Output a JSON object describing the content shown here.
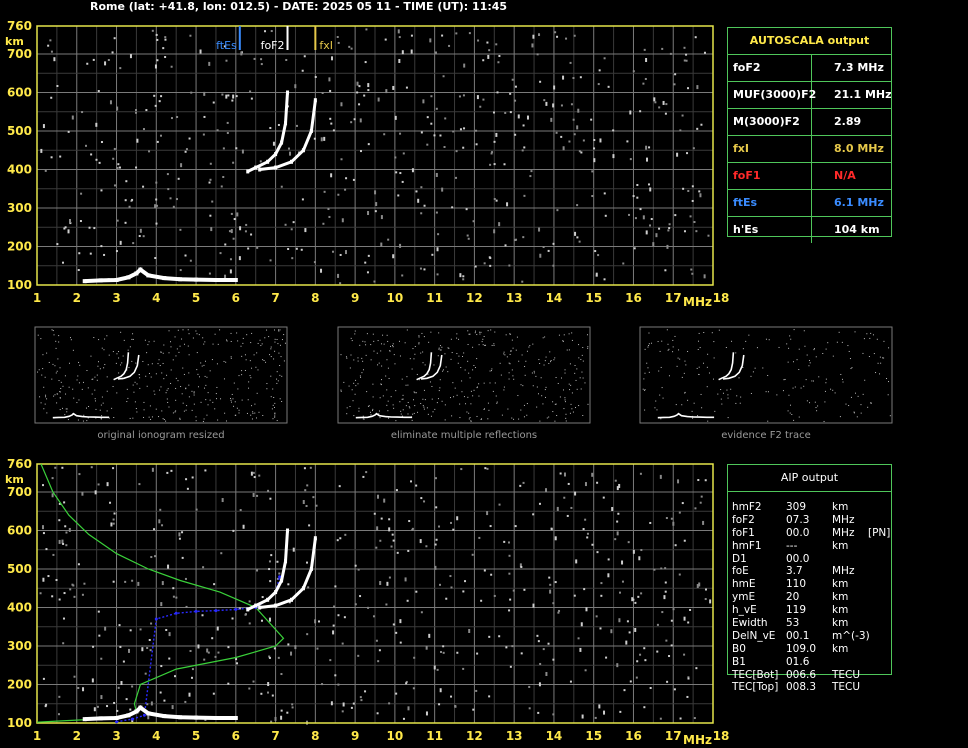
{
  "header": "Rome (lat: +41.8, lon: 012.5) - DATE: 2025 05 11 - TIME (UT): 11:45",
  "axes": {
    "x_ticks": [
      "1",
      "2",
      "3",
      "4",
      "5",
      "6",
      "7",
      "8",
      "9",
      "10",
      "11",
      "12",
      "13",
      "14",
      "15",
      "16",
      "17",
      "18"
    ],
    "y_ticks": [
      "760",
      "700",
      "600",
      "500",
      "400",
      "300",
      "200",
      "100"
    ],
    "x_unit": "MHz",
    "y_unit": "km"
  },
  "top_plot_labels": {
    "ftEs": "ftEs",
    "foF2": "foF2",
    "fxI": "fxI"
  },
  "autoscala": {
    "title": "AUTOSCALA output",
    "rows": [
      {
        "name": "foF2",
        "value": "7.3 MHz",
        "color": "#ffffff"
      },
      {
        "name": "MUF(3000)F2",
        "value": "21.1 MHz",
        "color": "#ffffff"
      },
      {
        "name": "M(3000)F2",
        "value": "2.89",
        "color": "#ffffff"
      },
      {
        "name": "fxI",
        "value": "8.0 MHz",
        "color": "#e6c84a"
      },
      {
        "name": "foF1",
        "value": "N/A",
        "color": "#ff2a2a"
      },
      {
        "name": "ftEs",
        "value": "6.1 MHz",
        "color": "#3a8cff"
      },
      {
        "name": "h'Es",
        "value": "104    km",
        "color": "#ffffff"
      }
    ]
  },
  "thumbnails": [
    {
      "caption": "original ionogram resized"
    },
    {
      "caption": "eliminate multiple reflections"
    },
    {
      "caption": "evidence F2 trace"
    }
  ],
  "aip": {
    "title": "AIP output",
    "rows": [
      {
        "k": "hmF2",
        "v": "309",
        "u": "km",
        "e": ""
      },
      {
        "k": "foF2",
        "v": "07.3",
        "u": "MHz",
        "e": ""
      },
      {
        "k": "foF1",
        "v": "00.0",
        "u": "MHz",
        "e": "[PN]"
      },
      {
        "k": "hmF1",
        "v": "---",
        "u": "km",
        "e": ""
      },
      {
        "k": "D1",
        "v": "00.0",
        "u": "",
        "e": ""
      },
      {
        "k": "foE",
        "v": "3.7",
        "u": "MHz",
        "e": ""
      },
      {
        "k": "hmE",
        "v": "110",
        "u": "km",
        "e": ""
      },
      {
        "k": "ymE",
        "v": "20",
        "u": "km",
        "e": ""
      },
      {
        "k": "h_vE",
        "v": "119",
        "u": "km",
        "e": ""
      },
      {
        "k": "Ewidth",
        "v": "53",
        "u": "km",
        "e": ""
      },
      {
        "k": "DelN_vE",
        "v": "00.1",
        "u": "m^(-3)",
        "e": ""
      },
      {
        "k": "B0",
        "v": "109.0",
        "u": "km",
        "e": ""
      },
      {
        "k": "B1",
        "v": "01.6",
        "u": "",
        "e": ""
      },
      {
        "k": "TEC[Bot]",
        "v": "006.6",
        "u": "TECU",
        "e": ""
      },
      {
        "k": "TEC[Top]",
        "v": "008.3",
        "u": "TECU",
        "e": ""
      }
    ]
  },
  "colors": {
    "frame": "#e6e64a",
    "grid": "#7a7a7a",
    "tick_label": "#ffe94a",
    "table_border": "#4fc65a",
    "ftEs": "#3a8cff",
    "fxI": "#e6c84a",
    "profile": "#3ad03a",
    "trace_fit": "#2a2aff"
  },
  "chart_data": [
    {
      "type": "scatter",
      "name": "autoscala-ionogram",
      "xlabel": "MHz",
      "ylabel": "km",
      "xlim": [
        1,
        18
      ],
      "ylim": [
        100,
        760
      ],
      "markers": [
        {
          "label": "ftEs",
          "x": 6.1
        },
        {
          "label": "foF2",
          "x": 7.3
        },
        {
          "label": "fxI",
          "x": 8.0
        }
      ],
      "series": [
        {
          "name": "Es",
          "x": [
            2.2,
            2.6,
            3.0,
            3.3,
            3.5,
            3.6,
            3.8,
            4.2,
            4.6,
            5.0,
            5.5,
            6.0
          ],
          "y": [
            110,
            112,
            113,
            120,
            130,
            140,
            125,
            118,
            115,
            114,
            113,
            113
          ]
        },
        {
          "name": "O-trace",
          "x": [
            6.3,
            6.5,
            6.8,
            7.0,
            7.15,
            7.25,
            7.3
          ],
          "y": [
            395,
            405,
            420,
            440,
            470,
            520,
            600
          ]
        },
        {
          "name": "X-trace",
          "x": [
            6.6,
            7.0,
            7.4,
            7.7,
            7.9,
            8.0
          ],
          "y": [
            400,
            405,
            420,
            450,
            500,
            580
          ]
        }
      ]
    },
    {
      "type": "line",
      "name": "aip-profile",
      "xlabel": "MHz",
      "ylabel": "km",
      "xlim": [
        1,
        18
      ],
      "ylim": [
        100,
        760
      ],
      "series": [
        {
          "name": "profile",
          "x": [
            1.1,
            1.4,
            1.8,
            2.3,
            3.0,
            3.8,
            4.6,
            5.6,
            6.5,
            7.2,
            7.0,
            6.0,
            4.5,
            3.6,
            3.45,
            3.5,
            3.3,
            2.5,
            1.5,
            1.0
          ],
          "y": [
            760,
            700,
            640,
            590,
            540,
            500,
            470,
            440,
            400,
            320,
            300,
            270,
            240,
            200,
            150,
            130,
            120,
            110,
            105,
            102
          ]
        },
        {
          "name": "trace-fit",
          "x": [
            3.0,
            3.4,
            3.7,
            4.0,
            4.5,
            5.0,
            5.5,
            6.0,
            6.5,
            6.8,
            7.0,
            7.1
          ],
          "y": [
            103,
            110,
            120,
            370,
            385,
            390,
            392,
            395,
            400,
            420,
            440,
            480
          ]
        },
        {
          "name": "O-trace",
          "x": [
            6.3,
            6.5,
            6.8,
            7.0,
            7.15,
            7.25,
            7.3
          ],
          "y": [
            395,
            405,
            420,
            440,
            470,
            520,
            600
          ]
        },
        {
          "name": "X-trace",
          "x": [
            6.6,
            7.0,
            7.4,
            7.7,
            7.9,
            8.0
          ],
          "y": [
            400,
            405,
            420,
            450,
            500,
            580
          ]
        },
        {
          "name": "Es",
          "x": [
            2.2,
            2.6,
            3.0,
            3.3,
            3.5,
            3.6,
            3.8,
            4.2,
            4.6,
            5.0,
            5.5,
            6.0
          ],
          "y": [
            110,
            112,
            113,
            120,
            130,
            140,
            125,
            118,
            115,
            114,
            113,
            113
          ]
        }
      ]
    }
  ]
}
